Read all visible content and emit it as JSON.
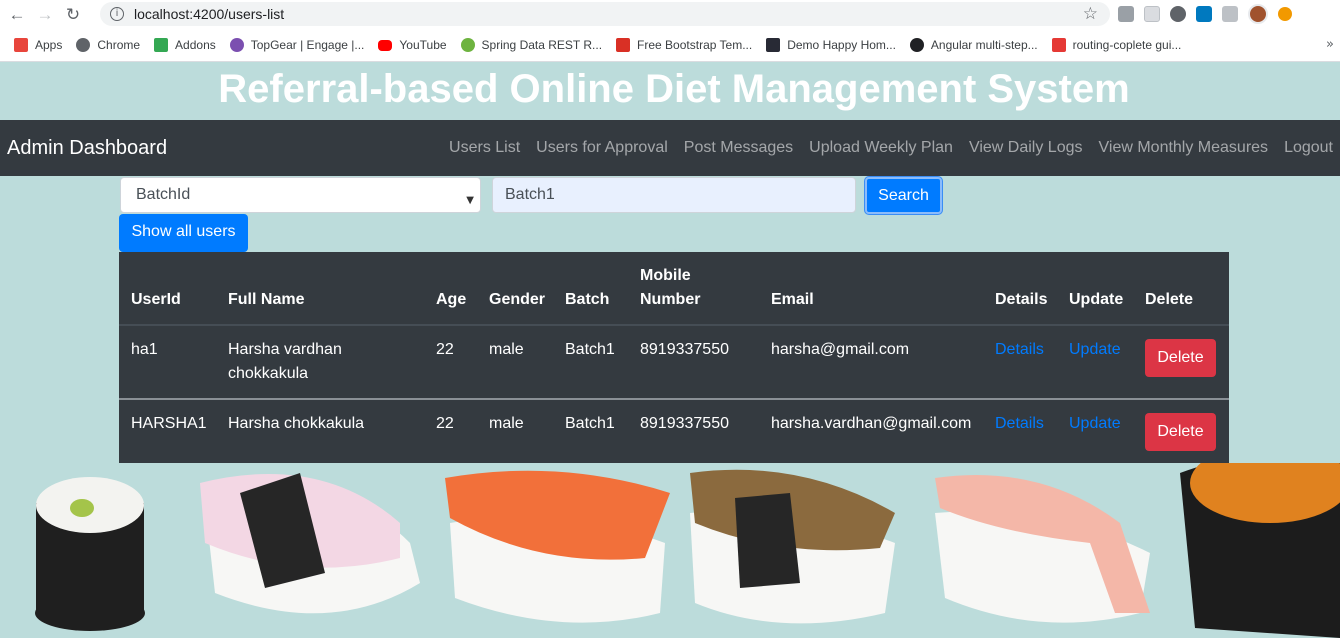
{
  "browser": {
    "url": "localhost:4200/users-list",
    "bookmarks": [
      {
        "label": "Apps",
        "icon": "apps-grid-icon",
        "color": "#e8453c"
      },
      {
        "label": "Chrome",
        "icon": "globe-icon",
        "color": "#5f6368"
      },
      {
        "label": "Addons",
        "icon": "puzzle-icon",
        "color": "#34a853"
      },
      {
        "label": "TopGear | Engage |...",
        "icon": "topgear-icon",
        "color": "#7b4fb0"
      },
      {
        "label": "YouTube",
        "icon": "youtube-icon",
        "color": "#ff0000"
      },
      {
        "label": "Spring Data REST R...",
        "icon": "spring-icon",
        "color": "#6db33f"
      },
      {
        "label": "Free Bootstrap Tem...",
        "icon": "s-logo-icon",
        "color": "#d93025"
      },
      {
        "label": "Demo Happy Hom...",
        "icon": "w3-icon",
        "color": "#282a35"
      },
      {
        "label": "Angular multi-step...",
        "icon": "g-logo-icon",
        "color": "#202124"
      },
      {
        "label": "routing-coplete gui...",
        "icon": "routing-icon",
        "color": "#e53935"
      }
    ]
  },
  "header": {
    "title": "Referral-based Online Diet Management System"
  },
  "navbar": {
    "brand": "Admin Dashboard",
    "links": [
      "Users List",
      "Users for Approval",
      "Post Messages",
      "Upload Weekly Plan",
      "View Daily Logs",
      "View Monthly Measures",
      "Logout"
    ]
  },
  "filter": {
    "select_value": "BatchId",
    "input_value": "Batch1",
    "search_label": "Search",
    "show_all_label": "Show all users"
  },
  "table": {
    "headers": [
      "UserId",
      "Full Name",
      "Age",
      "Gender",
      "Batch",
      "Mobile Number",
      "Email",
      "Details",
      "Update",
      "Delete"
    ],
    "rows": [
      {
        "userid": "ha1",
        "fullname": "Harsha vardhan chokkakula",
        "age": "22",
        "gender": "male",
        "batch": "Batch1",
        "mobile": "8919337550",
        "email": "harsha@gmail.com",
        "details": "Details",
        "update": "Update",
        "delete": "Delete"
      },
      {
        "userid": "HARSHA1",
        "fullname": "Harsha chokkakula",
        "age": "22",
        "gender": "male",
        "batch": "Batch1",
        "mobile": "8919337550",
        "email": "harsha.vardhan@gmail.com",
        "details": "Details",
        "update": "Update",
        "delete": "Delete"
      }
    ]
  },
  "colors": {
    "background": "#bcdcdb",
    "navbar": "#343a40",
    "primary": "#007bff",
    "danger": "#dc3545"
  }
}
